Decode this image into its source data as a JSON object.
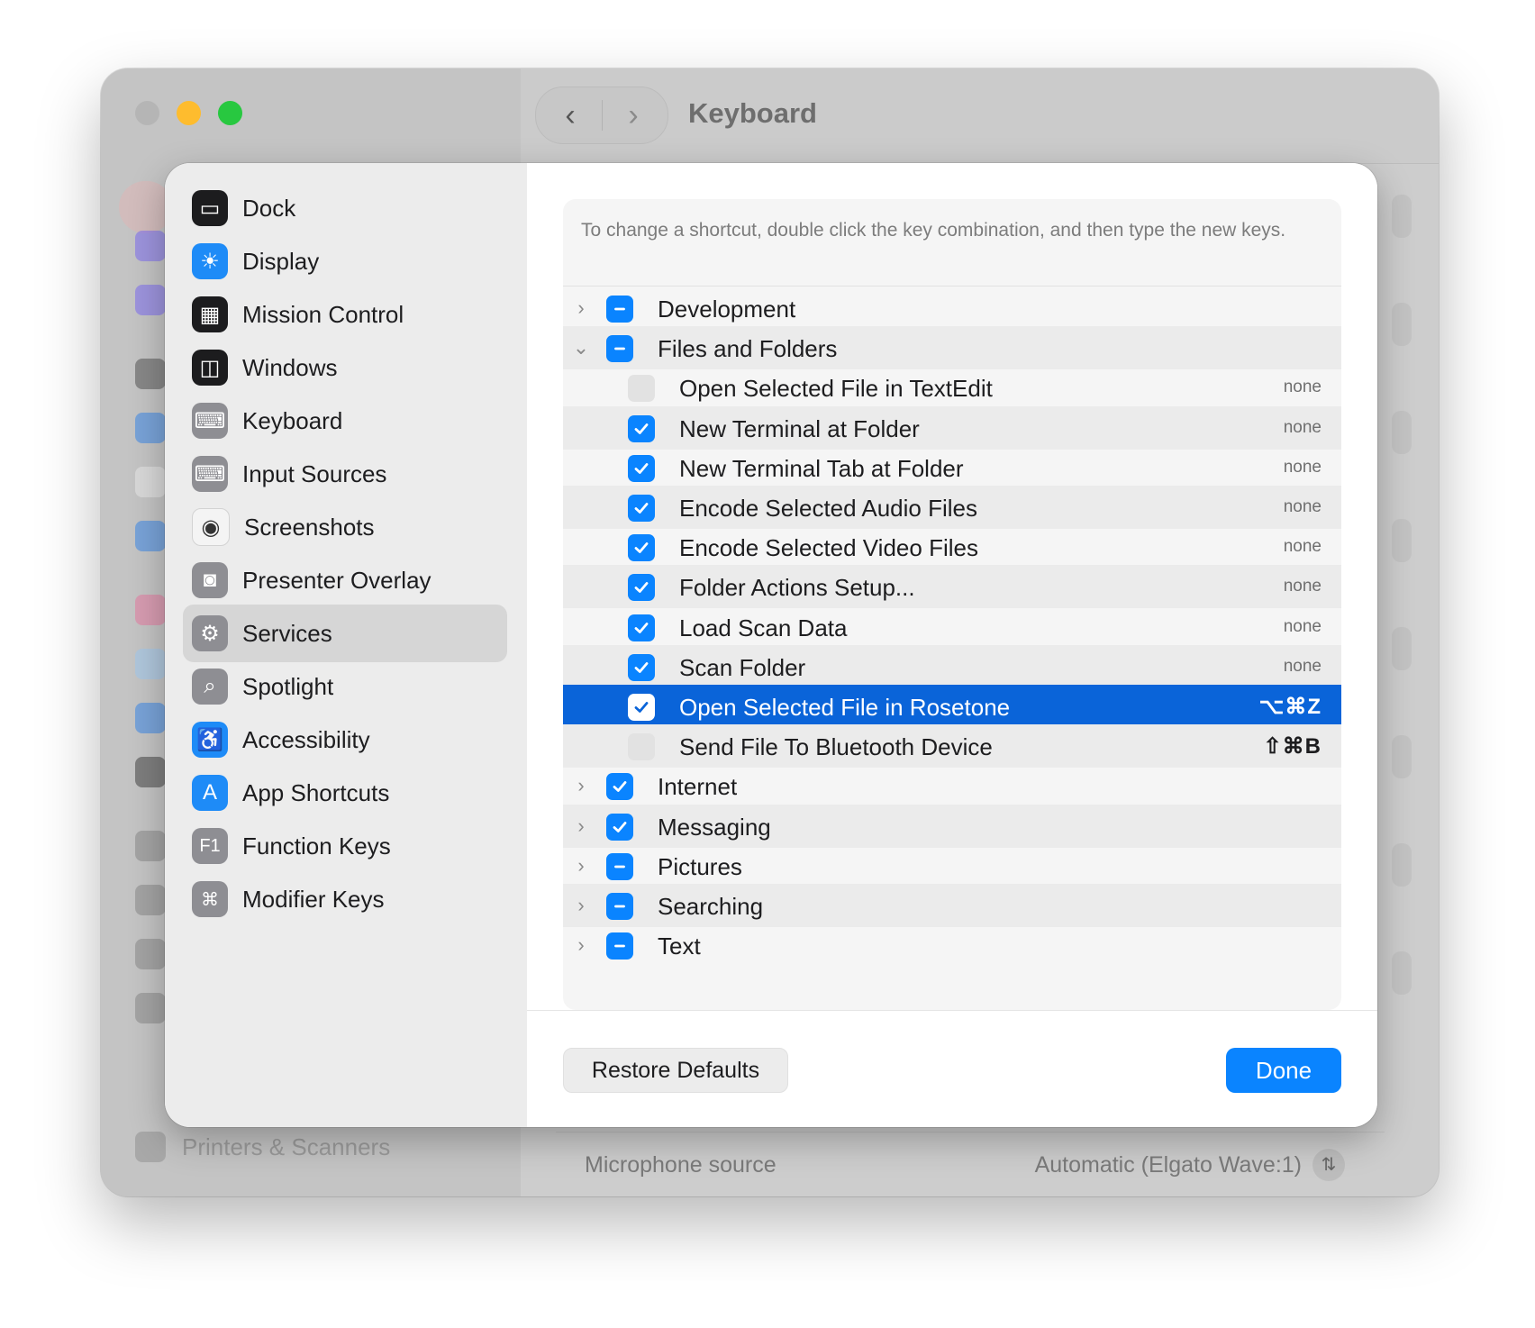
{
  "window": {
    "title": "Keyboard",
    "nav_back": "‹",
    "nav_forward": "›",
    "bg_sidebar_label": "Printers & Scanners",
    "mic_label": "Microphone source",
    "mic_value": "Automatic (Elgato Wave:1)"
  },
  "sidebar": {
    "items": [
      {
        "label": "Dock",
        "icon": "dock-icon"
      },
      {
        "label": "Display",
        "icon": "display-icon"
      },
      {
        "label": "Mission Control",
        "icon": "mission-control-icon"
      },
      {
        "label": "Windows",
        "icon": "windows-icon"
      },
      {
        "label": "Keyboard",
        "icon": "keyboard-icon"
      },
      {
        "label": "Input Sources",
        "icon": "input-sources-icon"
      },
      {
        "label": "Screenshots",
        "icon": "screenshots-icon"
      },
      {
        "label": "Presenter Overlay",
        "icon": "presenter-overlay-icon"
      },
      {
        "label": "Services",
        "icon": "services-icon",
        "active": true
      },
      {
        "label": "Spotlight",
        "icon": "spotlight-icon"
      },
      {
        "label": "Accessibility",
        "icon": "accessibility-icon"
      },
      {
        "label": "App Shortcuts",
        "icon": "app-shortcuts-icon"
      },
      {
        "label": "Function Keys",
        "icon": "function-keys-icon",
        "glyph": "F1"
      },
      {
        "label": "Modifier Keys",
        "icon": "modifier-keys-icon",
        "glyph": "⌘"
      }
    ]
  },
  "content": {
    "hint": "To change a shortcut, double click the key combination, and then type the new keys.",
    "rows": [
      {
        "label": "Development",
        "state": "mixed",
        "level": 0,
        "expander": "›"
      },
      {
        "label": "Files and Folders",
        "state": "mixed",
        "level": 0,
        "expander": "⌄"
      },
      {
        "label": "Open Selected File in TextEdit",
        "state": "unchecked",
        "level": 1,
        "shortcut": "none"
      },
      {
        "label": "New Terminal at Folder",
        "state": "checked",
        "level": 1,
        "shortcut": "none"
      },
      {
        "label": "New Terminal Tab at Folder",
        "state": "checked",
        "level": 1,
        "shortcut": "none"
      },
      {
        "label": "Encode Selected Audio Files",
        "state": "checked",
        "level": 1,
        "shortcut": "none"
      },
      {
        "label": "Encode Selected Video Files",
        "state": "checked",
        "level": 1,
        "shortcut": "none"
      },
      {
        "label": "Folder Actions Setup...",
        "state": "checked",
        "level": 1,
        "shortcut": "none"
      },
      {
        "label": "Load Scan Data",
        "state": "checked",
        "level": 1,
        "shortcut": "none"
      },
      {
        "label": "Scan Folder",
        "state": "checked",
        "level": 1,
        "shortcut": "none"
      },
      {
        "label": "Open Selected File in Rosetone",
        "state": "checked",
        "level": 1,
        "shortcut": "⌥⌘Z",
        "selected": true
      },
      {
        "label": "Send File To Bluetooth Device",
        "state": "unchecked",
        "level": 1,
        "shortcut": "⇧⌘B"
      },
      {
        "label": "Internet",
        "state": "checked",
        "level": 0,
        "expander": "›"
      },
      {
        "label": "Messaging",
        "state": "checked",
        "level": 0,
        "expander": "›"
      },
      {
        "label": "Pictures",
        "state": "mixed",
        "level": 0,
        "expander": "›"
      },
      {
        "label": "Searching",
        "state": "mixed",
        "level": 0,
        "expander": "›"
      },
      {
        "label": "Text",
        "state": "mixed",
        "level": 0,
        "expander": "›"
      }
    ],
    "restore_label": "Restore Defaults",
    "done_label": "Done"
  },
  "colors": {
    "accent": "#0a84ff",
    "selection": "#0a64d9",
    "traffic_minimize": "#febc2e",
    "traffic_maximize": "#28c840"
  }
}
